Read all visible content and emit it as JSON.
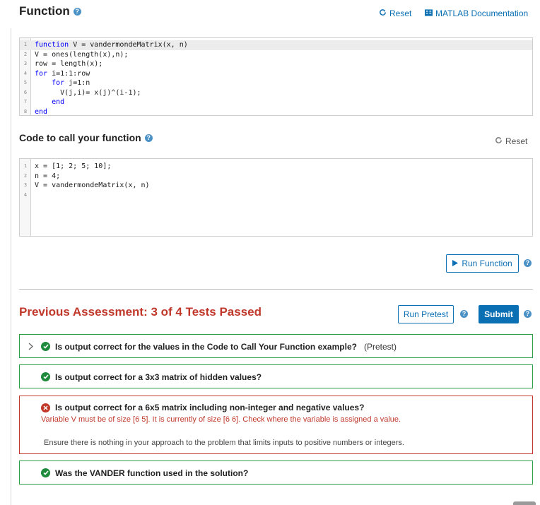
{
  "function_section": {
    "title": "Function",
    "reset_label": "Reset",
    "docs_label": "MATLAB Documentation",
    "lines": [
      {
        "n": "1",
        "pre": "",
        "kw": "function",
        "post": " V = vandermondeMatrix(x, n)"
      },
      {
        "n": "2",
        "pre": "V = ones(length(x),n);",
        "kw": "",
        "post": ""
      },
      {
        "n": "3",
        "pre": "row = length(x);",
        "kw": "",
        "post": ""
      },
      {
        "n": "4",
        "pre": "",
        "kw": "for",
        "post": " i=1:1:row"
      },
      {
        "n": "5",
        "pre": "    ",
        "kw": "for",
        "post": " j=1:n"
      },
      {
        "n": "6",
        "pre": "      V(j,i)= x(j)^(i-1);",
        "kw": "",
        "post": ""
      },
      {
        "n": "7",
        "pre": "    ",
        "kw": "end",
        "post": ""
      },
      {
        "n": "8",
        "pre": "",
        "kw": "end",
        "post": ""
      }
    ]
  },
  "call_section": {
    "title": "Code to call your function",
    "reset_label": "Reset",
    "lines": [
      {
        "n": "1",
        "text": "x = [1; 2; 5; 10];"
      },
      {
        "n": "2",
        "text": "n = 4;"
      },
      {
        "n": "3",
        "text": "V = vandermondeMatrix(x, n)"
      },
      {
        "n": "4",
        "text": ""
      }
    ],
    "run_label": "Run Function"
  },
  "assessment": {
    "title": "Previous Assessment: 3 of 4 Tests Passed",
    "run_pretest_label": "Run Pretest",
    "submit_label": "Submit",
    "tests": [
      {
        "status": "pass",
        "label": "Is output correct for the values in the Code to Call Your Function example?",
        "tag": "(Pretest)"
      },
      {
        "status": "pass",
        "label": "Is output correct for a 3x3 matrix of hidden values?"
      },
      {
        "status": "fail",
        "label": "Is output correct for a 6x5 matrix including non-integer and negative values?",
        "error": "Variable V must be of size [6 5]. It is currently of size [6 6]. Check where the variable is assigned a value.",
        "note": "Ensure there is nothing in your approach to the problem that limits inputs to positive numbers or integers."
      },
      {
        "status": "pass",
        "label": "Was the VANDER function used in the solution?"
      }
    ]
  },
  "colors": {
    "accent": "#0b6fb3",
    "pass": "#1f8a3c",
    "fail": "#c0392b"
  }
}
